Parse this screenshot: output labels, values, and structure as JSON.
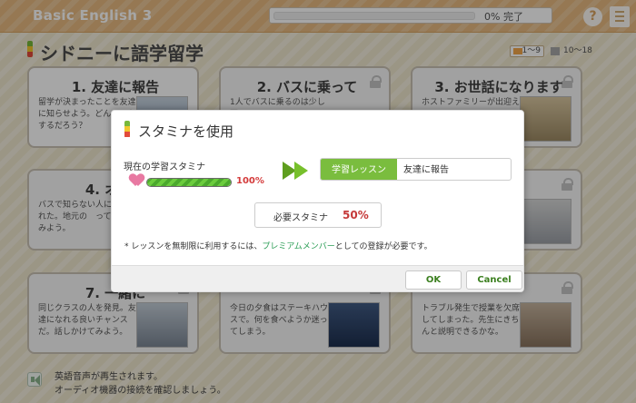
{
  "app": {
    "title": "Basic English 3",
    "progress_text": "0% 完了",
    "help_symbol": "?",
    "section_title": "シドニーに語学留学",
    "range_badges": [
      "1〜9",
      "10〜18"
    ]
  },
  "lessons": [
    {
      "title": "1. 友達に報告",
      "desc": "留学が決まったことを友達に知らせよう。どん　　をするだろう？",
      "locked": false
    },
    {
      "title": "2. バスに乗って",
      "desc": "1人でバスに乗るのは少し不",
      "locked": true
    },
    {
      "title": "3. お世話になります",
      "desc": "ホストファミリーが出迎え",
      "locked": true
    },
    {
      "title": "4. オスス",
      "desc": "バスで知らない人に　けられた。地元の　って聞いてみよう。",
      "locked": true
    },
    {
      "title": "",
      "desc": "",
      "locked": true
    },
    {
      "title": "業",
      "desc": "",
      "locked": true
    },
    {
      "title": "7. 一緒に",
      "desc": "同じクラスの人を発見。友達になれる良いチャンスだ。話しかけてみよう。",
      "locked": true
    },
    {
      "title": "",
      "desc": "今日の夕食はステーキハウスで。何を食べようか迷ってしまう。",
      "locked": true
    },
    {
      "title": "",
      "desc": "トラブル発生で授業を欠席してしまった。先生にきちんと説明できるかな。",
      "locked": true
    }
  ],
  "footer": {
    "line1": "英語音声が再生されます。",
    "line2": "オーディオ機器の接続を確認しましょう。"
  },
  "dialog": {
    "title": "スタミナを使用",
    "current_stamina_label": "現在の学習スタミナ",
    "current_stamina_value": "100%",
    "current_stamina_fraction": 1.0,
    "chip_label": "学習レッスン",
    "chip_value": "友達に報告",
    "needed_label": "必要スタミナ",
    "needed_value": "50%",
    "note_prefix": "* レッスンを無制限に利用するには、",
    "note_premium": "プレミアムメンバー",
    "note_suffix": "としての登録が必要です。",
    "ok_label": "OK",
    "cancel_label": "Cancel"
  },
  "colors": {
    "accent_green": "#7abd3e",
    "topbar": "#e6b980",
    "premium": "#2a9d55",
    "needed": "#c53939"
  }
}
